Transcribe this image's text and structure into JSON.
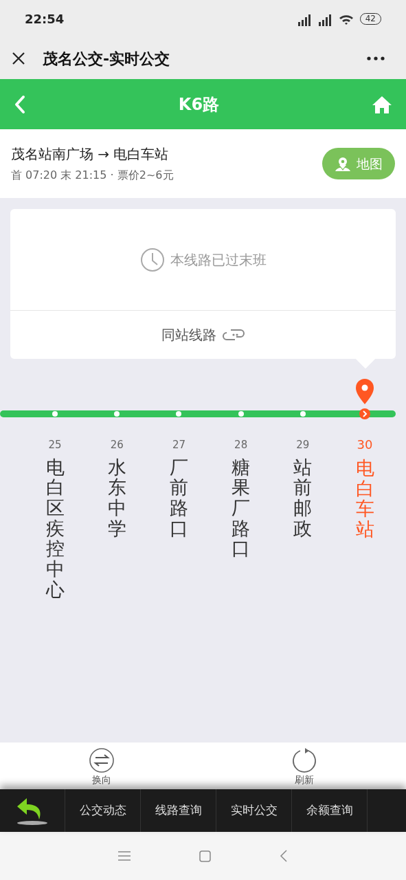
{
  "status_bar": {
    "time": "22:54",
    "battery": "42"
  },
  "window": {
    "title": "茂名公交-实时公交"
  },
  "header": {
    "title": "K6路"
  },
  "route": {
    "direction": "茂名站南广场 → 电白车站",
    "info": "首 07:20 末 21:15 · 票价2~6元",
    "map_button": "地图"
  },
  "notice": {
    "message": "本线路已过末班",
    "same_station_link": "同站线路"
  },
  "stops": [
    {
      "number": "25",
      "name": "电白区疾控中心",
      "selected": false
    },
    {
      "number": "26",
      "name": "水东中学",
      "selected": false
    },
    {
      "number": "27",
      "name": "厂前路口",
      "selected": false
    },
    {
      "number": "28",
      "name": "糖果厂路口",
      "selected": false
    },
    {
      "number": "29",
      "name": "站前邮政",
      "selected": false
    },
    {
      "number": "30",
      "name": "电白车站",
      "selected": true
    }
  ],
  "actions": [
    {
      "kind": "reverse",
      "label": "换向"
    },
    {
      "kind": "refresh",
      "label": "刷新"
    }
  ],
  "menu": [
    "公交动态",
    "线路查询",
    "实时公交",
    "余额查询"
  ]
}
